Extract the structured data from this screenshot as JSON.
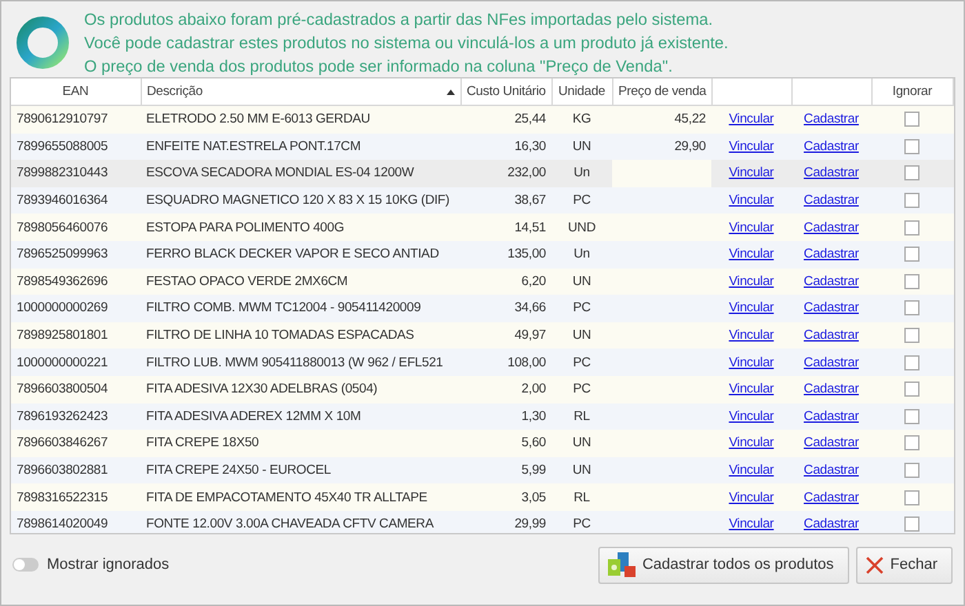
{
  "info": {
    "lines": [
      "Os produtos abaixo foram pré-cadastrados a partir das NFes importadas pelo sistema.",
      "Você pode cadastrar estes produtos no sistema ou vinculá-los a um produto já existente.",
      "O preço de venda dos produtos pode ser informado na coluna \"Preço de Venda\"."
    ]
  },
  "table": {
    "columns": [
      {
        "label": "EAN",
        "sorted": false
      },
      {
        "label": "Descrição",
        "sorted": true
      },
      {
        "label": "Custo Unitário",
        "sorted": false
      },
      {
        "label": "Unidade",
        "sorted": false
      },
      {
        "label": "Preço de venda",
        "sorted": false
      },
      {
        "sorted": false
      },
      {
        "sorted": false
      },
      {
        "label": "Ignorar",
        "sorted": false
      }
    ],
    "rows": [
      {
        "ean": "7890612910797",
        "description": "ELETRODO 2.50 MM E-6013 GERDAU",
        "cost": "25,44",
        "unit": "KG",
        "price": "45,22",
        "link": "Vincular",
        "action": "Cadastrar",
        "ignored": false,
        "selected": false
      },
      {
        "ean": "7899655088005",
        "description": "ENFEITE NAT.ESTRELA PONT.17CM",
        "cost": "16,30",
        "unit": "UN",
        "price": "29,90",
        "link": "Vincular",
        "action": "Cadastrar",
        "ignored": false,
        "selected": false
      },
      {
        "ean": "7899882310443",
        "description": "ESCOVA SECADORA MONDIAL ES-04 1200W",
        "cost": "232,00",
        "unit": "Un",
        "link": "Vincular",
        "action": "Cadastrar",
        "ignored": false,
        "selected": true
      },
      {
        "ean": "7893946016364",
        "description": "ESQUADRO MAGNETICO 120 X 83 X 15  10KG (DIF)",
        "cost": "38,67",
        "unit": "PC",
        "link": "Vincular",
        "action": "Cadastrar",
        "ignored": false,
        "selected": false
      },
      {
        "ean": "7898056460076",
        "description": "ESTOPA PARA POLIMENTO 400G",
        "cost": "14,51",
        "unit": "UND",
        "link": "Vincular",
        "action": "Cadastrar",
        "ignored": false,
        "selected": false
      },
      {
        "ean": "7896525099963",
        "description": "FERRO BLACK DECKER VAPOR E SECO ANTIAD",
        "cost": "135,00",
        "unit": "Un",
        "link": "Vincular",
        "action": "Cadastrar",
        "ignored": false,
        "selected": false
      },
      {
        "ean": "7898549362696",
        "description": "FESTAO OPACO VERDE 2MX6CM",
        "cost": "6,20",
        "unit": "UN",
        "link": "Vincular",
        "action": "Cadastrar",
        "ignored": false,
        "selected": false
      },
      {
        "ean": "1000000000269",
        "description": "FILTRO COMB. MWM TC12004 - 905411420009",
        "cost": "34,66",
        "unit": "PC",
        "link": "Vincular",
        "action": "Cadastrar",
        "ignored": false,
        "selected": false
      },
      {
        "ean": "7898925801801",
        "description": "FILTRO DE LINHA 10 TOMADAS ESPACADAS",
        "cost": "49,97",
        "unit": "UN",
        "link": "Vincular",
        "action": "Cadastrar",
        "ignored": false,
        "selected": false
      },
      {
        "ean": "1000000000221",
        "description": "FILTRO LUB. MWM 905411880013 (W 962 / EFL521",
        "cost": "108,00",
        "unit": "PC",
        "link": "Vincular",
        "action": "Cadastrar",
        "ignored": false,
        "selected": false
      },
      {
        "ean": "7896603800504",
        "description": "FITA ADESIVA 12X30 ADELBRAS (0504)",
        "cost": "2,00",
        "unit": "PC",
        "link": "Vincular",
        "action": "Cadastrar",
        "ignored": false,
        "selected": false
      },
      {
        "ean": "7896193262423",
        "description": "FITA ADESIVA ADEREX 12MM X 10M",
        "cost": "1,30",
        "unit": "RL",
        "link": "Vincular",
        "action": "Cadastrar",
        "ignored": false,
        "selected": false
      },
      {
        "ean": "7896603846267",
        "description": "FITA CREPE 18X50",
        "cost": "5,60",
        "unit": "UN",
        "link": "Vincular",
        "action": "Cadastrar",
        "ignored": false,
        "selected": false
      },
      {
        "ean": "7896603802881",
        "description": "FITA CREPE 24X50 -  EUROCEL",
        "cost": "5,99",
        "unit": "UN",
        "link": "Vincular",
        "action": "Cadastrar",
        "ignored": false,
        "selected": false
      },
      {
        "ean": "7898316522315",
        "description": "FITA DE EMPACOTAMENTO 45X40 TR ALLTAPE",
        "cost": "3,05",
        "unit": "RL",
        "link": "Vincular",
        "action": "Cadastrar",
        "ignored": false,
        "selected": false
      },
      {
        "ean": "7898614020049",
        "description": "FONTE 12.00V  3.00A CHAVEADA CFTV CAMERA",
        "cost": "29,99",
        "unit": "PC",
        "link": "Vincular",
        "action": "Cadastrar",
        "ignored": false,
        "selected": false
      }
    ]
  },
  "footer": {
    "toggle": {
      "label": "Mostrar ignorados",
      "on": false
    },
    "buttons": [
      {
        "kind": "register",
        "label": "Cadastrar todos os produtos"
      },
      {
        "kind": "close",
        "label": "Fechar"
      }
    ]
  }
}
